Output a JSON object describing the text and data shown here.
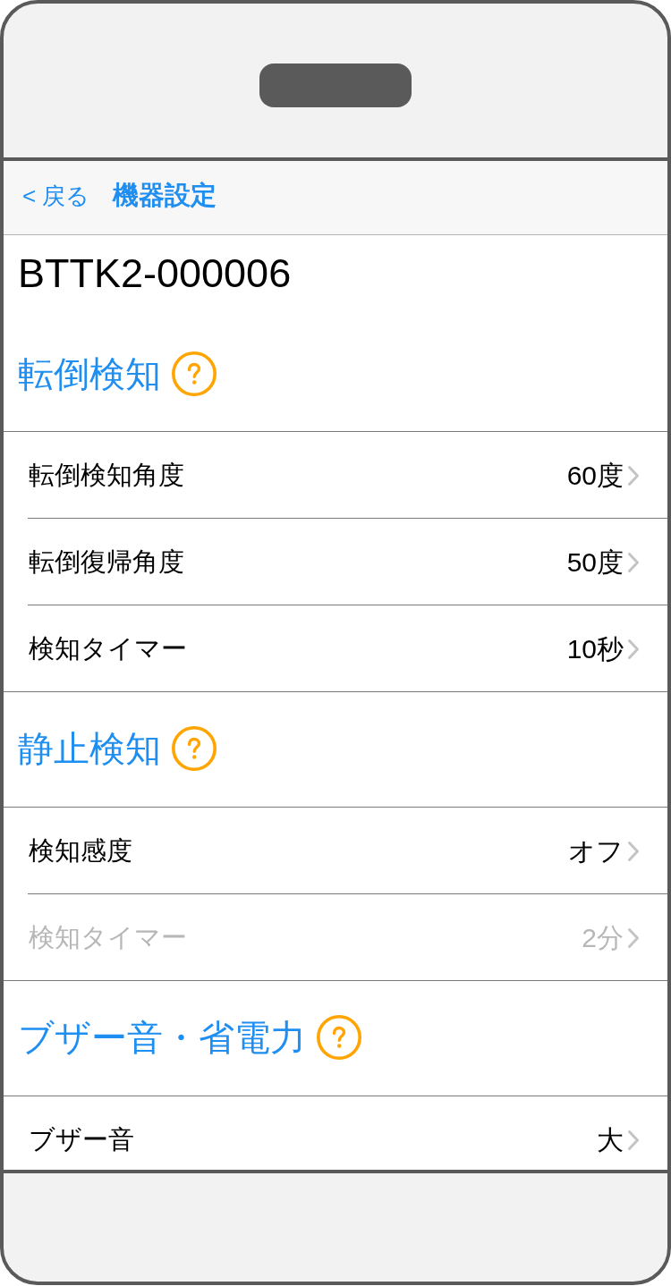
{
  "nav_bar": {
    "back_label": "< 戻る",
    "title": "機器設定"
  },
  "device_id": "BTTK2-000006",
  "sections": [
    {
      "title": "転倒検知",
      "rows": [
        {
          "label": "転倒検知角度",
          "value": "60度",
          "disabled": false
        },
        {
          "label": "転倒復帰角度",
          "value": "50度",
          "disabled": false
        },
        {
          "label": "検知タイマー",
          "value": "10秒",
          "disabled": false
        }
      ]
    },
    {
      "title": "静止検知",
      "rows": [
        {
          "label": "検知感度",
          "value": "オフ",
          "disabled": false
        },
        {
          "label": "検知タイマー",
          "value": "2分",
          "disabled": true
        }
      ]
    },
    {
      "title": "ブザー音・省電力",
      "rows": [
        {
          "label": "ブザー音",
          "value": "大",
          "disabled": false
        }
      ]
    }
  ]
}
